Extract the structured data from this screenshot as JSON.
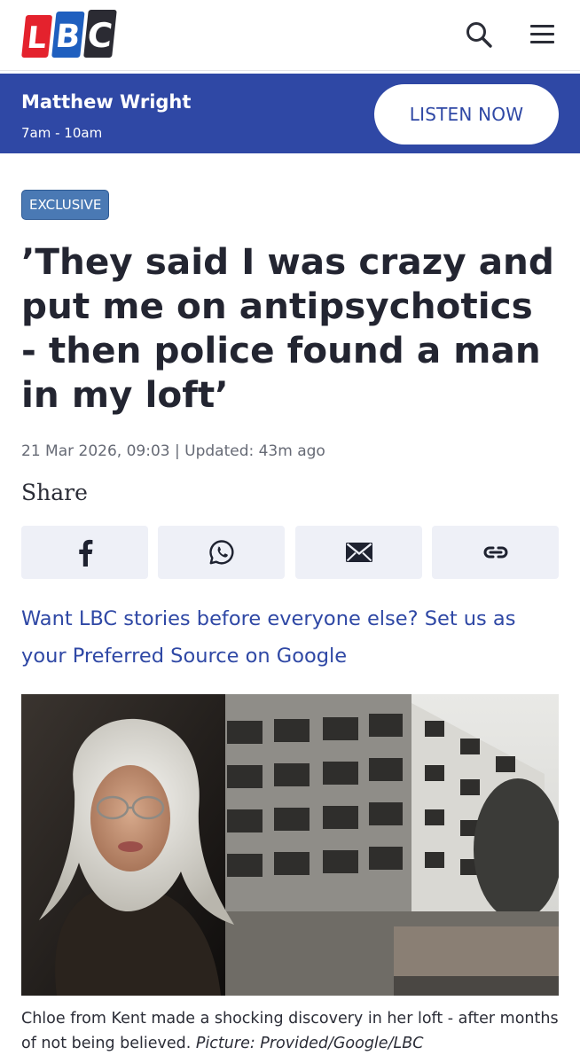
{
  "header": {
    "logo_letters": [
      "L",
      "B",
      "C"
    ],
    "icons": {
      "search": "search-icon",
      "menu": "hamburger-menu-icon"
    }
  },
  "live_bar": {
    "show_name": "Matthew Wright",
    "show_time": "7am - 10am",
    "listen_label": "LISTEN NOW"
  },
  "article": {
    "badge": "EXCLUSIVE",
    "headline": "’They said I was crazy and put me on antipsychotics - then police found a man in my loft’",
    "published": "21 Mar 2026, 09:03",
    "separator": "|",
    "updated": "Updated: 43m ago",
    "share_label": "Share",
    "share_buttons": [
      {
        "name": "facebook",
        "icon": "facebook-icon"
      },
      {
        "name": "whatsapp",
        "icon": "whatsapp-icon"
      },
      {
        "name": "email",
        "icon": "email-icon"
      },
      {
        "name": "copy-link",
        "icon": "link-icon"
      }
    ],
    "cta": "Want LBC stories before everyone else? Set us as your Preferred Source on Google",
    "image": {
      "caption_text": "Chloe from Kent made a shocking discovery in her loft - after months of not being believed.",
      "caption_credit": "Picture: Provided/Google/LBC"
    }
  },
  "colors": {
    "brand_blue": "#2f48a5",
    "badge_blue": "#4a79b4",
    "logo_red": "#e4222d",
    "logo_blue": "#1f5fbf",
    "logo_dark": "#2b2b33",
    "share_bg": "#eef0f7"
  }
}
